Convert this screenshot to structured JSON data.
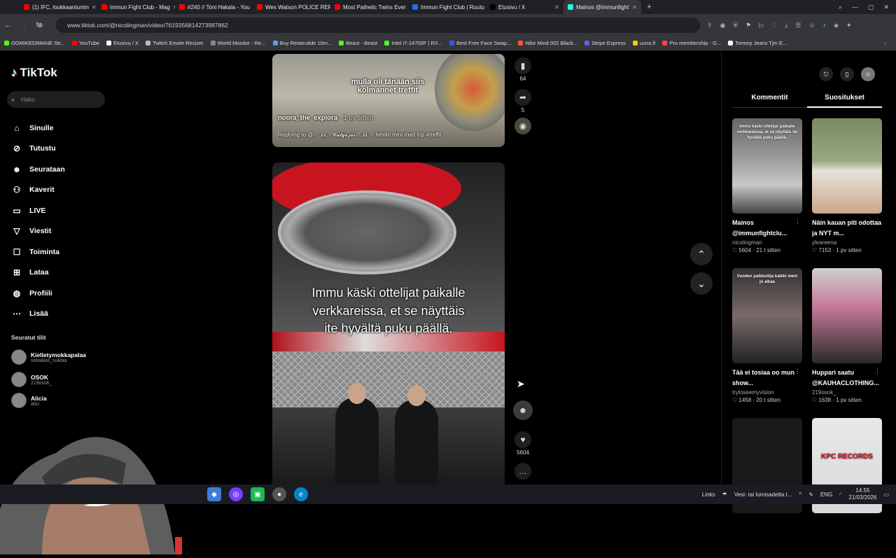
{
  "browser": {
    "tabs": [
      {
        "label": "(1) IFC, loukkaantumin",
        "color": "#ff0000"
      },
      {
        "label": "Immun Fight Club - Mag",
        "color": "#ff0000"
      },
      {
        "label": "#240 // Toni Hakala - You",
        "color": "#ff0000"
      },
      {
        "label": "Wes Watson POLICE REPO",
        "color": "#ff0000"
      },
      {
        "label": "Most Pathetic Twins Ever",
        "color": "#ff0000"
      },
      {
        "label": "Immun Fight Club | Ruutu",
        "color": "#1a73e8"
      },
      {
        "label": "Etusivu / X",
        "color": "#000000"
      },
      {
        "label": "Mainos @immunfight",
        "color": "#25f4ee"
      }
    ],
    "new_tab": "+",
    "url": "www.tiktok.com/@nicolingman/video/7619356814273987862",
    "bookmarks": [
      {
        "label": "OGMIKEDIMANE Str...",
        "color": "#53fc18"
      },
      {
        "label": "YouTube",
        "color": "#ff0000"
      },
      {
        "label": "Etusivu / X",
        "color": "#ffffff"
      },
      {
        "label": "Twitch Emote Resizer",
        "color": "#bbbbbb"
      },
      {
        "label": "World Monitor - Re...",
        "color": "#888888"
      },
      {
        "label": "Buy Retatrutide 10m...",
        "color": "#4aa3ff"
      },
      {
        "label": "Beast - Beast",
        "color": "#53fc18"
      },
      {
        "label": "Intel i7-14700F | RX...",
        "color": "#53fc18"
      },
      {
        "label": "Best Free Face Swap...",
        "color": "#3355ff"
      },
      {
        "label": "Nike Mind 002 Black...",
        "color": "#ff5533"
      },
      {
        "label": "Stripe Express",
        "color": "#635bff"
      },
      {
        "label": "uuno.fi",
        "color": "#ffcc00"
      },
      {
        "label": "Pro membership - G...",
        "color": "#ff4444"
      },
      {
        "label": "Tommy Jeans Tjm E...",
        "color": "#ffffff"
      }
    ]
  },
  "tiktok": {
    "logo": "TikTok",
    "search_placeholder": "Haku",
    "menu": [
      {
        "label": "Sinulle",
        "icon": "home-icon"
      },
      {
        "label": "Tutustu",
        "icon": "compass-icon"
      },
      {
        "label": "Seurataan",
        "icon": "following-icon"
      },
      {
        "label": "Kaverit",
        "icon": "friends-icon"
      },
      {
        "label": "LIVE",
        "icon": "live-icon"
      },
      {
        "label": "Viestit",
        "icon": "messages-icon"
      },
      {
        "label": "Toiminta",
        "icon": "activity-icon"
      },
      {
        "label": "Lataa",
        "icon": "upload-icon"
      },
      {
        "label": "Profiili",
        "icon": "profile-icon"
      },
      {
        "label": "Lisää",
        "icon": "more-icon"
      }
    ],
    "following_title": "Seuratut tilit",
    "following": [
      {
        "name": "Kielletymokkapalaa",
        "sub": "sekaikas_sukiaa"
      },
      {
        "name": "OSOK",
        "sub": "219osok_"
      },
      {
        "name": "Alicia",
        "sub": "alici"
      }
    ],
    "video1": {
      "caption": "mulla oli tänään siis kolmannet treffit",
      "author": "noora_the_explora",
      "time": "· 1 pv sitten",
      "reply": "Replying to @♡..ᕱ..♡𝓒𝓪𝓽𝓰𝓮𝓳𝓮𝓻♡..ᕱ..♡ tehtiin mini road trip #treffit",
      "saves": "64",
      "shares": "5"
    },
    "video2": {
      "caption": "Immu käski ottelijat paikalle verkkareissa, et se näyttäis ite hyvältä puku päällä.",
      "likes": "5604"
    },
    "right_tabs": {
      "comments": "Kommentit",
      "recommend": "Suositukset"
    },
    "cards": [
      {
        "title": "Mainos @immunfightclu...",
        "author": "nicolingman",
        "stats": "♡ 5604 · 21 t sitten",
        "thumb_text": "Immu käski ottelijat paikalle verkkareissa, et se näyttäis ite hyvältä puku päällä."
      },
      {
        "title": "Näin kauan piti odottaa ja NYT m...",
        "author": "yleareena",
        "stats": "♡ 7153 · 1 pv sitten",
        "thumb_text": ""
      },
      {
        "title": "Tää ei tosiaa oo mun show...",
        "author": "trytoseemyvision",
        "stats": "♡ 1458 · 20 t sitten",
        "thumb_text": "Vuoden paikkoilija kaikki meni jo aikaa"
      },
      {
        "title": "Huppari saatu @KAUHACLOTHING...",
        "author": "219osok_",
        "stats": "♡ 1638 · 1 pv sitten",
        "thumb_text": ""
      },
      {
        "title": "",
        "author": "",
        "stats": "",
        "thumb_text": ""
      },
      {
        "title": "",
        "author": "",
        "stats": "",
        "thumb_text": "KPC RECORDS"
      }
    ]
  },
  "taskbar": {
    "links": "Links",
    "weather": "Vesi- tai lumisadetta t...",
    "lang": "ENG",
    "time": "14.55",
    "date": "21/03/2026"
  }
}
